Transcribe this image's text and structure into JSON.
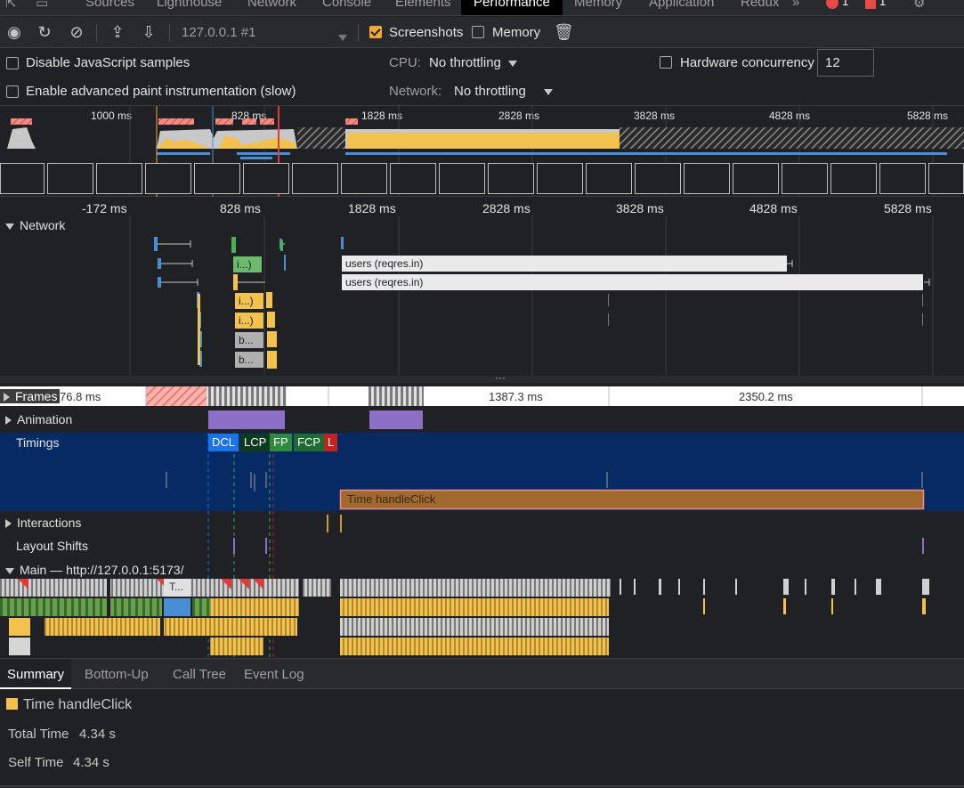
{
  "tabs": {
    "sources": "Sources",
    "lighthouse": "Lighthouse",
    "network": "Network",
    "console": "Console",
    "elements": "Elements",
    "performance": "Performance",
    "memory": "Memory",
    "application": "Application",
    "redux": "Redux",
    "more": "»",
    "errors_count": "1",
    "issues_count": "1"
  },
  "toolbar": {
    "profile_select": "127.0.0.1 #1",
    "screenshots_label": "Screenshots",
    "screenshots_checked": true,
    "memory_label": "Memory",
    "memory_checked": false
  },
  "settings": {
    "disable_js_samples": "Disable JavaScript samples",
    "enable_paint": "Enable advanced paint instrumentation (slow)",
    "cpu_label": "CPU:",
    "cpu_value": "No throttling",
    "network_label": "Network:",
    "network_value": "No throttling",
    "hw_concurrency_label": "Hardware concurrency",
    "hw_concurrency_value": "12"
  },
  "overview": {
    "ticks": [
      "1000 ms",
      "828 ms",
      "1828 ms",
      "2828 ms",
      "3828 ms",
      "4828 ms",
      "5828 ms"
    ]
  },
  "ruler": {
    "ticks": [
      "-172 ms",
      "828 ms",
      "1828 ms",
      "2828 ms",
      "3828 ms",
      "4828 ms",
      "5828 ms"
    ]
  },
  "tracks": {
    "network": "Network",
    "frames": "Frames",
    "animation": "Animation",
    "timings": "Timings",
    "interactions": "Interactions",
    "layout_shifts": "Layout Shifts",
    "main": "Main — http://127.0.0.1:5173/"
  },
  "network_requests": {
    "users1": "users (reqres.in)",
    "users2": "users (reqres.in)",
    "green": "i...)",
    "y1": "i...)",
    "y2": "i...)",
    "g1": "b...",
    "g2": "b..."
  },
  "frames": {
    "f1": "76.8 ms",
    "f2": "1387.3 ms",
    "f3": "2350.2 ms"
  },
  "timing_marks": {
    "dcl": "DCL",
    "lcp": "LCP",
    "fp": "FP",
    "fcp": "FCP",
    "l": "L",
    "handle_click": "Time handleClick"
  },
  "main_thread": {
    "task_short": "T..."
  },
  "bottom_tabs": {
    "summary": "Summary",
    "bottom_up": "Bottom-Up",
    "call_tree": "Call Tree",
    "event_log": "Event Log"
  },
  "summary": {
    "title": "Time handleClick",
    "total_time_label": "Total Time",
    "total_time_value": "4.34 s",
    "self_time_label": "Self Time",
    "self_time_value": "4.34 s"
  },
  "colors": {
    "scripting": "#f2c14e",
    "rendering": "#9b7fd4",
    "painting": "#4caf50",
    "loading": "#4a8fd6",
    "timings_bg": "#062a63",
    "handle_click": "#a0692d"
  }
}
